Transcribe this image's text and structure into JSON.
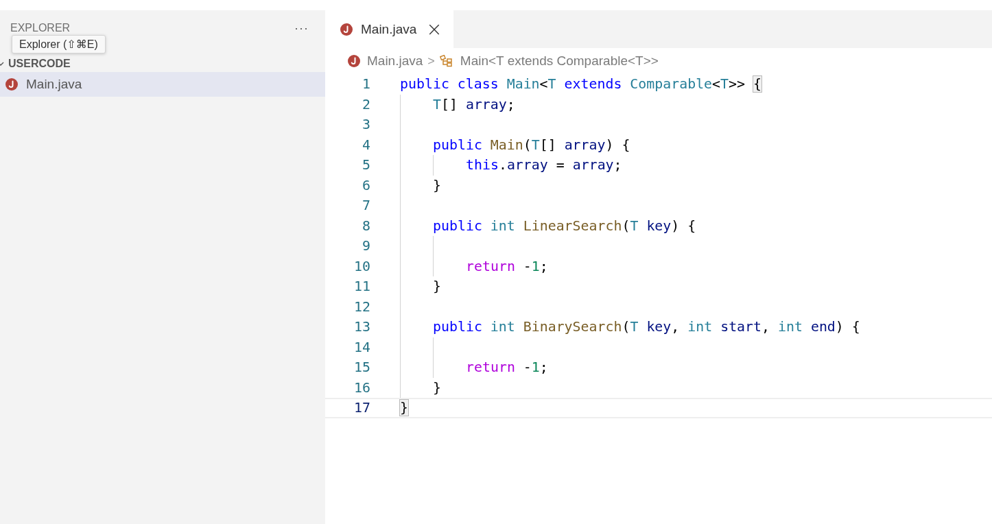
{
  "sidebar": {
    "title": "EXPLORER",
    "more": "···",
    "tooltip": "Explorer (⇧⌘E)",
    "section": {
      "label": "USERCODE",
      "expanded": true
    },
    "files": [
      {
        "name": "Main.java",
        "selected": true
      }
    ]
  },
  "tabs": [
    {
      "label": "Main.java",
      "selected": true,
      "close": "×"
    }
  ],
  "breadcrumbs": [
    {
      "kind": "file",
      "label": "Main.java"
    },
    {
      "kind": "class",
      "label": "Main<T extends Comparable<T>>"
    }
  ],
  "breadcrumb_separator": ">",
  "code": [
    {
      "number": "1",
      "current": false,
      "tokens": [
        {
          "kind": "keyword",
          "text": "public "
        },
        {
          "kind": "keyword",
          "text": "class "
        },
        {
          "kind": "type",
          "text": "Main"
        },
        {
          "kind": "plain",
          "text": "<"
        },
        {
          "kind": "type",
          "text": "T "
        },
        {
          "kind": "keyword",
          "text": "extends "
        },
        {
          "kind": "type",
          "text": "Comparable"
        },
        {
          "kind": "plain",
          "text": "<"
        },
        {
          "kind": "type",
          "text": "T"
        },
        {
          "kind": "plain",
          "text": ">> "
        },
        {
          "kind": "bracket",
          "text": "{"
        }
      ]
    },
    {
      "number": "2",
      "current": false,
      "guides": [
        true
      ],
      "tokens": [
        {
          "kind": "type",
          "text": "T"
        },
        {
          "kind": "plain",
          "text": "[] "
        },
        {
          "kind": "variable",
          "text": "array"
        },
        {
          "kind": "plain",
          "text": ";"
        }
      ]
    },
    {
      "number": "3",
      "current": false,
      "guides": [
        true
      ]
    },
    {
      "number": "4",
      "current": false,
      "guides": [
        true
      ],
      "tokens": [
        {
          "kind": "keyword",
          "text": "public "
        },
        {
          "kind": "function",
          "text": "Main"
        },
        {
          "kind": "plain",
          "text": "("
        },
        {
          "kind": "type",
          "text": "T"
        },
        {
          "kind": "plain",
          "text": "[] "
        },
        {
          "kind": "variable",
          "text": "array"
        },
        {
          "kind": "plain",
          "text": ") {"
        }
      ]
    },
    {
      "number": "5",
      "current": false,
      "guides": [
        true,
        true
      ],
      "tokens": [
        {
          "kind": "keyword",
          "text": "this"
        },
        {
          "kind": "plain",
          "text": "."
        },
        {
          "kind": "variable",
          "text": "array"
        },
        {
          "kind": "plain",
          "text": " = "
        },
        {
          "kind": "variable",
          "text": "array"
        },
        {
          "kind": "plain",
          "text": ";"
        }
      ]
    },
    {
      "number": "6",
      "current": false,
      "guides": [
        true
      ],
      "tokens": [
        {
          "kind": "plain",
          "text": "}"
        }
      ]
    },
    {
      "number": "7",
      "current": false,
      "guides": [
        true
      ]
    },
    {
      "number": "8",
      "current": false,
      "guides": [
        true
      ],
      "tokens": [
        {
          "kind": "keyword",
          "text": "public "
        },
        {
          "kind": "type",
          "text": "int "
        },
        {
          "kind": "function",
          "text": "LinearSearch"
        },
        {
          "kind": "plain",
          "text": "("
        },
        {
          "kind": "type",
          "text": "T "
        },
        {
          "kind": "variable",
          "text": "key"
        },
        {
          "kind": "plain",
          "text": ") {"
        }
      ]
    },
    {
      "number": "9",
      "current": false,
      "guides": [
        true,
        true
      ]
    },
    {
      "number": "10",
      "current": false,
      "guides": [
        true,
        true
      ],
      "tokens": [
        {
          "kind": "control",
          "text": "return"
        },
        {
          "kind": "plain",
          "text": " -"
        },
        {
          "kind": "number",
          "text": "1"
        },
        {
          "kind": "plain",
          "text": ";"
        }
      ]
    },
    {
      "number": "11",
      "current": false,
      "guides": [
        true
      ],
      "tokens": [
        {
          "kind": "plain",
          "text": "}"
        }
      ]
    },
    {
      "number": "12",
      "current": false,
      "guides": [
        true
      ]
    },
    {
      "number": "13",
      "current": false,
      "guides": [
        true
      ],
      "tokens": [
        {
          "kind": "keyword",
          "text": "public "
        },
        {
          "kind": "type",
          "text": "int "
        },
        {
          "kind": "function",
          "text": "BinarySearch"
        },
        {
          "kind": "plain",
          "text": "("
        },
        {
          "kind": "type",
          "text": "T "
        },
        {
          "kind": "variable",
          "text": "key"
        },
        {
          "kind": "plain",
          "text": ", "
        },
        {
          "kind": "type",
          "text": "int "
        },
        {
          "kind": "variable",
          "text": "start"
        },
        {
          "kind": "plain",
          "text": ", "
        },
        {
          "kind": "type",
          "text": "int "
        },
        {
          "kind": "variable",
          "text": "end"
        },
        {
          "kind": "plain",
          "text": ") {"
        }
      ]
    },
    {
      "number": "14",
      "current": false,
      "guides": [
        true,
        true
      ]
    },
    {
      "number": "15",
      "current": false,
      "guides": [
        true,
        true
      ],
      "tokens": [
        {
          "kind": "control",
          "text": "return"
        },
        {
          "kind": "plain",
          "text": " -"
        },
        {
          "kind": "number",
          "text": "1"
        },
        {
          "kind": "plain",
          "text": ";"
        }
      ]
    },
    {
      "number": "16",
      "current": false,
      "guides": [
        true
      ],
      "tokens": [
        {
          "kind": "plain",
          "text": "}"
        }
      ]
    },
    {
      "number": "17",
      "current": true,
      "tokens": [
        {
          "kind": "bracket",
          "text": "}"
        }
      ]
    }
  ]
}
